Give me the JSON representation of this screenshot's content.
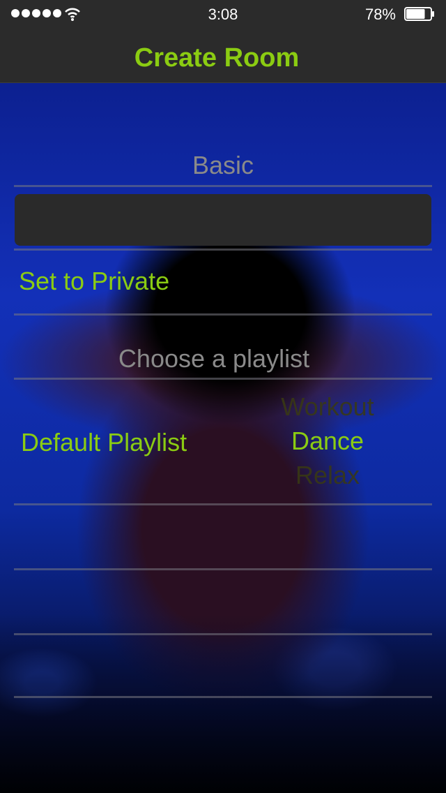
{
  "status_bar": {
    "time": "3:08",
    "battery_percent": "78%",
    "battery_level": 0.78,
    "signal_dots": 5,
    "icons": [
      "signal-dots-icon",
      "wifi-icon",
      "battery-icon"
    ]
  },
  "nav": {
    "title": "Create Room"
  },
  "basic_section": {
    "label": "Basic",
    "room_name_value": "",
    "room_name_placeholder": ""
  },
  "private_row": {
    "label": "Set to Private"
  },
  "playlist_section": {
    "label": "Choose  a playlist",
    "row_label": "Default Playlist",
    "picker_options": [
      "Workout",
      "Dance",
      "Relax"
    ],
    "selected": "Dance"
  },
  "colors": {
    "accent": "#8bcc12",
    "bar_background": "#2b2b2b",
    "section_label": "#8a8a8a"
  }
}
